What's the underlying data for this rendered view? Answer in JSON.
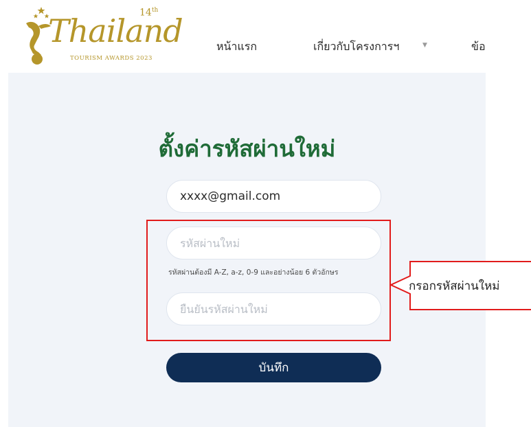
{
  "header": {
    "logo": {
      "wordmark": "Thailand",
      "edition": "14",
      "edition_suffix": "th",
      "subtitle": "TOURISM AWARDS 2023"
    },
    "nav": [
      {
        "label": "หน้าแรก"
      },
      {
        "label": "เกี่ยวกับโครงการฯ",
        "has_dropdown": true
      },
      {
        "label": "ข้อ"
      }
    ]
  },
  "form": {
    "title": "ตั้งค่ารหัสผ่านใหม่",
    "email_value": "xxxx@gmail.com",
    "password_placeholder": "รหัสผ่านใหม่",
    "password_hint": "รหัสผ่านต้องมี A-Z, a-z, 0-9 และอย่างน้อย 6 ตัวอักษร",
    "confirm_placeholder": "ยืนยันรหัสผ่านใหม่",
    "save_label": "บันทึก"
  },
  "annotation": {
    "callout_text": "กรอกรหัสผ่านใหม่",
    "color": "#e11b1b"
  },
  "colors": {
    "brand_gold": "#b5962a",
    "title_green": "#1f6b37",
    "button_navy": "#0f2d55",
    "panel_bg": "#f1f4f9"
  }
}
